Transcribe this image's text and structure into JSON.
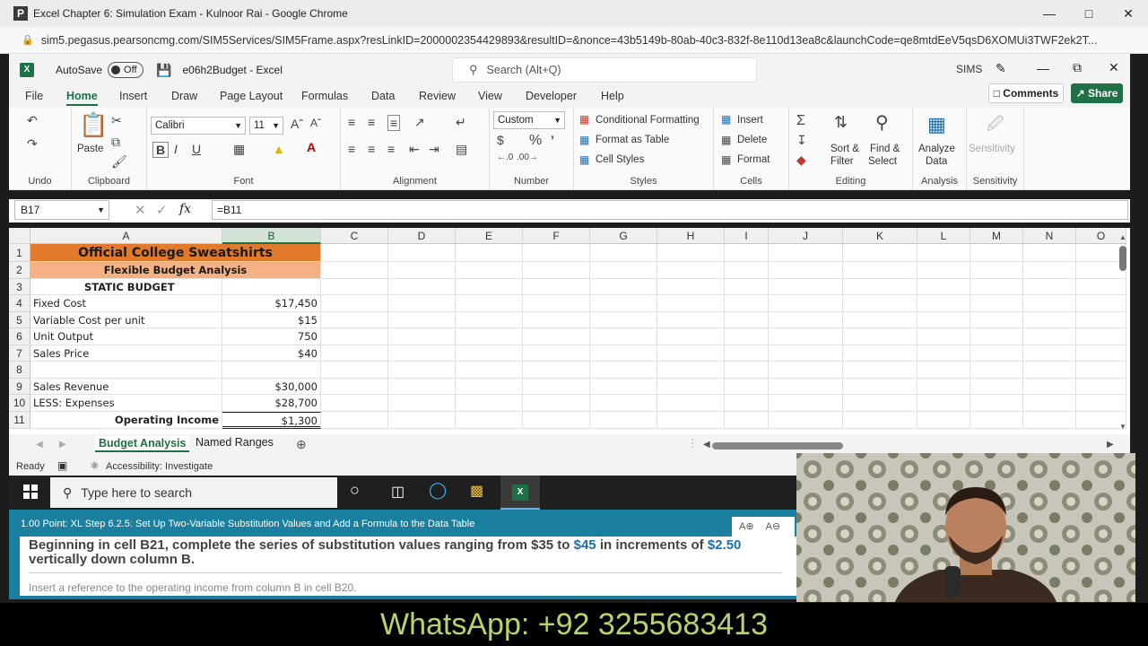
{
  "browser": {
    "app_icon": "P",
    "title": "Excel Chapter 6: Simulation Exam - Kulnoor Rai - Google Chrome",
    "url": "sim5.pegasus.pearsoncmg.com/SIM5Services/SIM5Frame.aspx?resLinkID=2000002354429893&resultID=&nonce=43b5149b-80ab-40c3-832f-8e110d13ea8c&launchCode=qe8mtdEeV5qsD6XOMUi3TWF2ek2T..."
  },
  "excel": {
    "autosave_label": "AutoSave",
    "autosave_state": "Off",
    "filename": "e06h2Budget - Excel",
    "search_placeholder": "Search (Alt+Q)",
    "sims_label": "SIMS"
  },
  "menu": {
    "tabs": [
      "File",
      "Home",
      "Insert",
      "Draw",
      "Page Layout",
      "Formulas",
      "Data",
      "Review",
      "View",
      "Developer",
      "Help"
    ],
    "active": "Home",
    "comments": "Comments",
    "share": "Share"
  },
  "ribbon": {
    "groups": {
      "undo": "Undo",
      "clipboard": "Clipboard",
      "font": "Font",
      "alignment": "Alignment",
      "number": "Number",
      "styles": "Styles",
      "cells": "Cells",
      "editing": "Editing",
      "analysis": "Analysis",
      "sensitivity": "Sensitivity"
    },
    "paste": "Paste",
    "font_name": "Calibri",
    "font_size": "11",
    "number_format": "Custom",
    "conditional_formatting": "Conditional Formatting",
    "format_as_table": "Format as Table",
    "cell_styles": "Cell Styles",
    "insert": "Insert",
    "delete": "Delete",
    "format": "Format",
    "sort_filter_1": "Sort &",
    "sort_filter_2": "Filter",
    "find_select_1": "Find &",
    "find_select_2": "Select",
    "analyze_1": "Analyze",
    "analyze_2": "Data",
    "sensitivity_btn": "Sensitivity"
  },
  "formula_bar": {
    "name_box": "B17",
    "formula": "=B11"
  },
  "columns": [
    "A",
    "B",
    "C",
    "D",
    "E",
    "F",
    "G",
    "H",
    "I",
    "J",
    "K",
    "L",
    "M",
    "N",
    "O"
  ],
  "rows": [
    {
      "num": "1",
      "a": "Official College Sweatshirts",
      "b": ""
    },
    {
      "num": "2",
      "a": "Flexible Budget Analysis",
      "b": ""
    },
    {
      "num": "3",
      "a": "STATIC BUDGET",
      "b": ""
    },
    {
      "num": "4",
      "a": "Fixed Cost",
      "b": "$17,450"
    },
    {
      "num": "5",
      "a": "Variable Cost per unit",
      "b": "$15"
    },
    {
      "num": "6",
      "a": "Unit Output",
      "b": "750"
    },
    {
      "num": "7",
      "a": "Sales Price",
      "b": "$40"
    },
    {
      "num": "8",
      "a": "",
      "b": ""
    },
    {
      "num": "9",
      "a": "Sales Revenue",
      "b": "$30,000"
    },
    {
      "num": "10",
      "a": "LESS: Expenses",
      "b": "$28,700"
    },
    {
      "num": "11",
      "a": "Operating Income",
      "b": "$1,300"
    }
  ],
  "sheets": {
    "active": "Budget Analysis",
    "other": "Named Ranges"
  },
  "status": {
    "ready": "Ready",
    "accessibility": "Accessibility: Investigate"
  },
  "taskbar": {
    "search_placeholder": "Type here to search"
  },
  "task": {
    "header": "1.00 Point: XL Step 6.2.5: Set Up Two-Variable Substitution Values and Add a Formula to the Data Table",
    "main_1": "Beginning in cell B21, complete the series of substitution values ranging from $35 to ",
    "main_hl1": "$45",
    "main_2": " in increments of ",
    "main_hl2": "$2.50",
    "main_3": " vertically down column B.",
    "next": "Insert a reference to the operating income from column B in cell B20.",
    "font_up": "A",
    "font_down": "A"
  },
  "banner": {
    "text": "WhatsApp: +92 3255683413"
  },
  "colors": {
    "excel_green": "#1e7145",
    "header_orange": "#e2792b",
    "subheader_orange": "#f4b183",
    "task_blue": "#1b7fa0",
    "banner_text": "#b6d36c"
  }
}
